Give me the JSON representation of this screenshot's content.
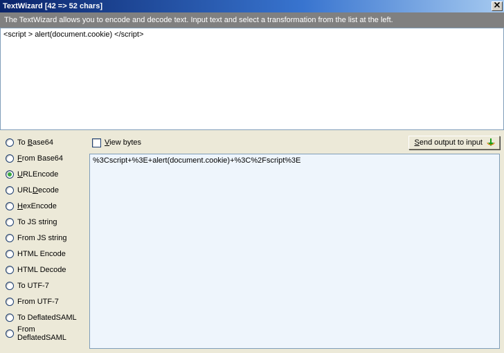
{
  "titlebar": {
    "title": "TextWizard [42 => 52 chars]",
    "close": "×"
  },
  "description": "The TextWizard allows you to encode and decode text. Input text and select a transformation from the list at the left.",
  "input_text": "<script > alert(document.cookie) </script>",
  "transforms": [
    {
      "label": "To Base64",
      "underline_index": 3,
      "selected": false
    },
    {
      "label": "From Base64",
      "underline_index": 0,
      "selected": false
    },
    {
      "label": "URLEncode",
      "underline_index": 0,
      "selected": true
    },
    {
      "label": "URLDecode",
      "underline_index": 3,
      "selected": false
    },
    {
      "label": "HexEncode",
      "underline_index": 0,
      "selected": false
    },
    {
      "label": "To JS string",
      "underline_index": -1,
      "selected": false
    },
    {
      "label": "From JS string",
      "underline_index": -1,
      "selected": false
    },
    {
      "label": "HTML Encode",
      "underline_index": -1,
      "selected": false
    },
    {
      "label": "HTML Decode",
      "underline_index": -1,
      "selected": false
    },
    {
      "label": "To UTF-7",
      "underline_index": -1,
      "selected": false
    },
    {
      "label": "From UTF-7",
      "underline_index": -1,
      "selected": false
    },
    {
      "label": "To DeflatedSAML",
      "underline_index": -1,
      "selected": false
    },
    {
      "label": "From DeflatedSAML",
      "underline_index": -1,
      "selected": false
    }
  ],
  "toolbar": {
    "view_bytes_label": "View bytes",
    "view_bytes_underline_index": 0,
    "view_bytes_checked": false,
    "send_label": "Send output to input",
    "send_underline_index": 0
  },
  "output_text": "%3Cscript+%3E+alert(document.cookie)+%3C%2Fscript%3E"
}
